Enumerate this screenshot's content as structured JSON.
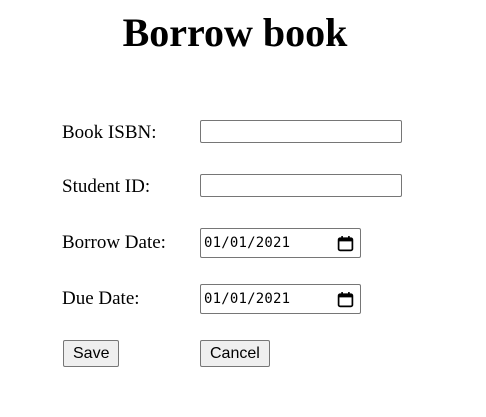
{
  "page": {
    "title": "Borrow book"
  },
  "form": {
    "isbn": {
      "label": "Book ISBN:",
      "value": ""
    },
    "student_id": {
      "label": "Student ID:",
      "value": ""
    },
    "borrow_date": {
      "label": "Borrow Date:",
      "value": "01/01/2021",
      "icon": "calendar-icon"
    },
    "due_date": {
      "label": "Due Date:",
      "value": "01/01/2021",
      "icon": "calendar-icon"
    }
  },
  "buttons": {
    "save_label": "Save",
    "cancel_label": "Cancel"
  }
}
